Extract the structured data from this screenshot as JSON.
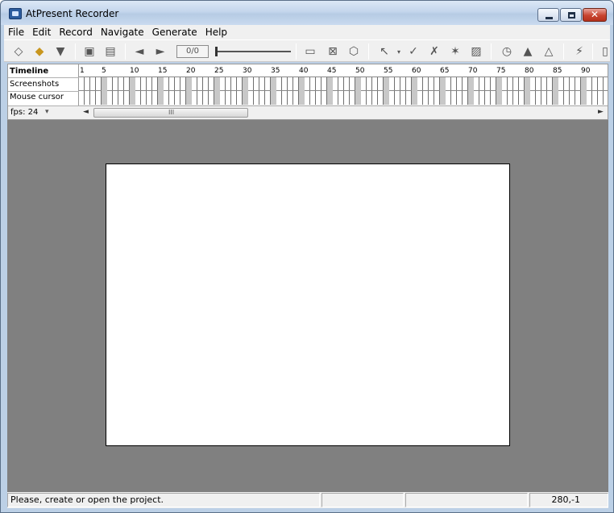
{
  "window": {
    "title": "AtPresent Recorder"
  },
  "menu": [
    "File",
    "Edit",
    "Record",
    "Navigate",
    "Generate",
    "Help"
  ],
  "toolbar": {
    "frame_counter": "0/0"
  },
  "timeline": {
    "row_labels": [
      "Timeline",
      "Screenshots",
      "Mouse cursor"
    ],
    "fps_label": "fps: 24",
    "ticks": [
      "1",
      "5",
      "10",
      "15",
      "20",
      "25",
      "30",
      "35",
      "40",
      "45",
      "50",
      "55",
      "60",
      "65",
      "70",
      "75",
      "80",
      "85",
      "90"
    ],
    "scroll_grip": "III"
  },
  "status": {
    "message": "Please, create or open the project.",
    "coords": "280,-1"
  }
}
